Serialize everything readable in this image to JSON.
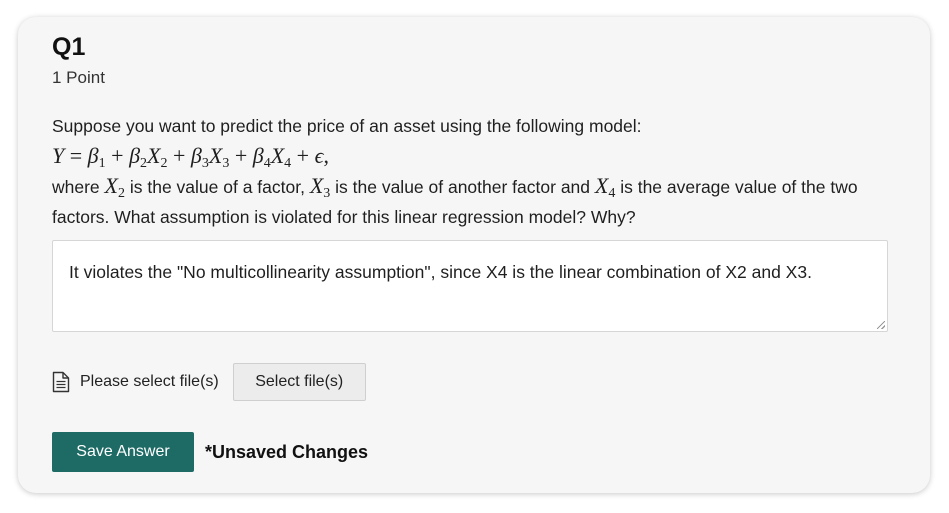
{
  "question": {
    "title": "Q1",
    "points": "1 Point",
    "intro": "Suppose you want to predict the price of an asset using the following model:",
    "equation": {
      "lhs": "Y",
      "eq": " = ",
      "terms": [
        "β",
        "1",
        " + ",
        "β",
        "2",
        "X",
        "2",
        " + ",
        "β",
        "3",
        "X",
        "3",
        " + ",
        "β",
        "4",
        "X",
        "4",
        " + ",
        "ϵ",
        ","
      ]
    },
    "where_prefix": "where ",
    "x2_var": "X",
    "x2_sub": "2",
    "where_mid1": " is the value of a factor, ",
    "x3_var": "X",
    "x3_sub": "3",
    "where_mid2": " is the value of another factor and ",
    "x4_var": "X",
    "x4_sub": "4",
    "where_end": " is the average value of the two factors. What assumption is violated for this linear regression model? Why?"
  },
  "answer": {
    "text": "It violates the \"No multicollinearity assumption\", since X4 is the linear combination of X2 and X3."
  },
  "file_upload": {
    "icon": "document-icon",
    "label": "Please select file(s)",
    "button_label": "Select file(s)"
  },
  "actions": {
    "save_label": "Save Answer",
    "status": "*Unsaved Changes",
    "accent_color": "#1e6b66"
  }
}
